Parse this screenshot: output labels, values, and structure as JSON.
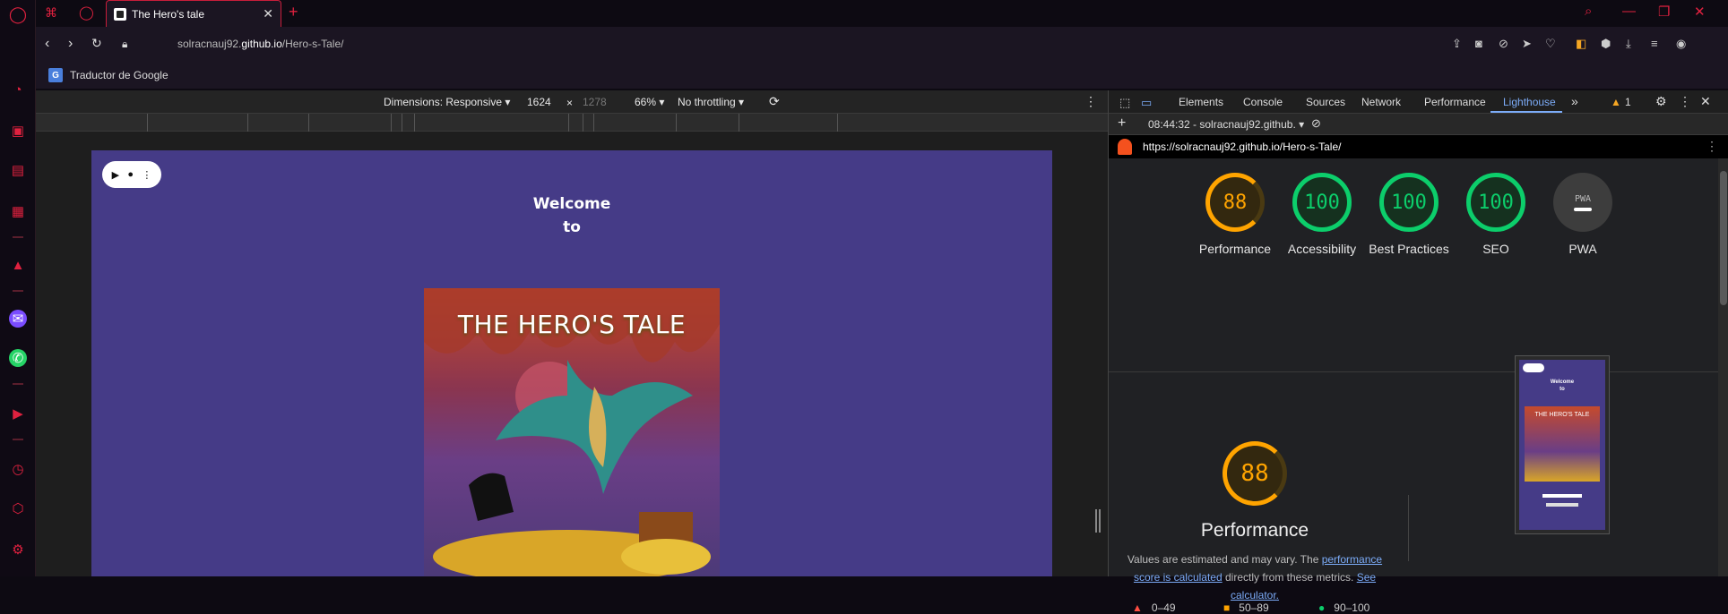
{
  "browser": {
    "tab_title": "The Hero's tale",
    "url_prefix": "solracnauj92.",
    "url_host": "github.io",
    "url_path": "/Hero-s-Tale/",
    "bookmark": "Traductor de Google"
  },
  "device_toolbar": {
    "dimensions": "Dimensions: Responsive",
    "width": "1624",
    "times": "×",
    "height": "1278",
    "zoom": "66%",
    "throttling": "No throttling"
  },
  "page": {
    "welcome_line1": "Welcome",
    "welcome_line2": "to",
    "cover_title": "THE HERO'S TALE"
  },
  "devtools": {
    "tabs": [
      "Elements",
      "Console",
      "Sources",
      "Network",
      "Performance",
      "Lighthouse"
    ],
    "more": "»",
    "warning_count": "1",
    "report_time": "08:44:32 - solracnauj92.github.",
    "report_url": "https://solracnauj92.github.io/Hero-s-Tale/",
    "scores": [
      {
        "label": "Performance",
        "value": "88",
        "status": "average"
      },
      {
        "label": "Accessibility",
        "value": "100",
        "status": "pass"
      },
      {
        "label": "Best Practices",
        "value": "100",
        "status": "pass"
      },
      {
        "label": "SEO",
        "value": "100",
        "status": "pass"
      },
      {
        "label": "PWA",
        "value": "PWA",
        "status": "na"
      }
    ],
    "big_score": "88",
    "big_title": "Performance",
    "desc_1": "Values are estimated and may vary. The ",
    "desc_link1": "performance score is calculated",
    "desc_2": " directly from these metrics. ",
    "desc_link2": "See calculator.",
    "legend": [
      "0–49",
      "50–89",
      "90–100"
    ],
    "thumb_welcome": "Welcome",
    "thumb_to": "to",
    "thumb_title": "THE HERO'S TALE"
  },
  "colors": {
    "opera_red": "#e0213f",
    "page_bg": "#453b87",
    "score_green": "#0cce6b",
    "score_orange": "#ffa400",
    "link_blue": "#7cacf8"
  }
}
